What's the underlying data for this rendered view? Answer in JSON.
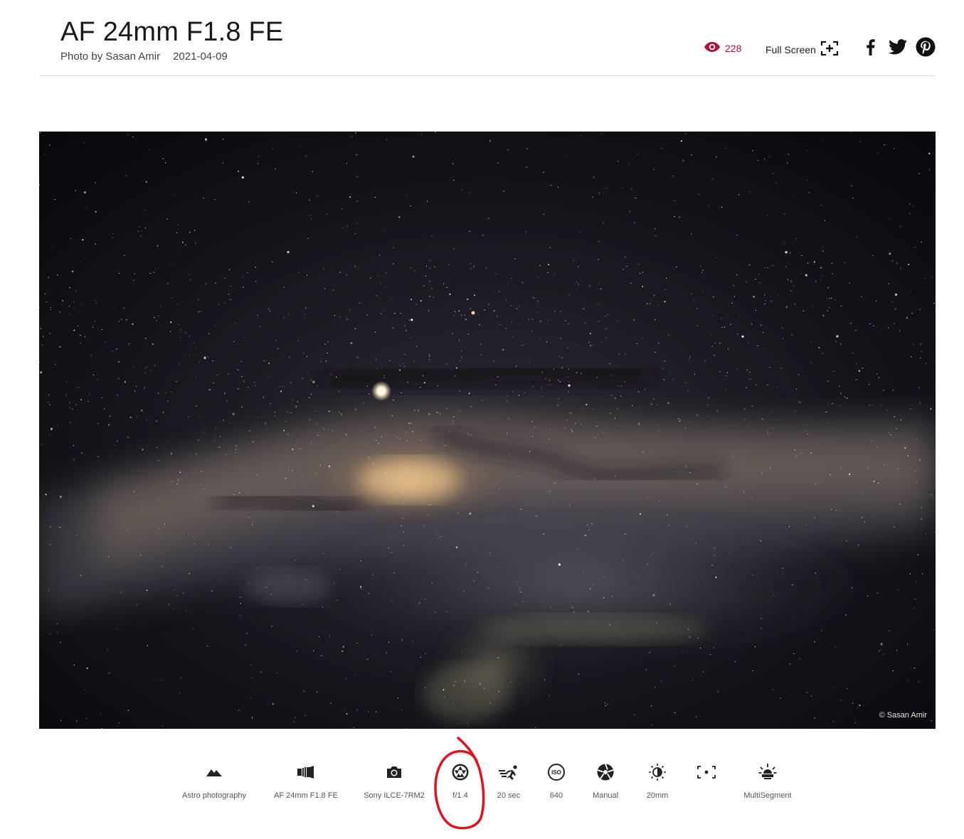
{
  "page": {
    "title": "AF 24mm F1.8 FE",
    "photographer_line": "Photo by Sasan Amir",
    "date": "2021-04-09"
  },
  "header_actions": {
    "views_count": "228",
    "fullscreen_label": "Full Screen",
    "accent_color": "#b5103c",
    "social": [
      {
        "name": "facebook-icon"
      },
      {
        "name": "twitter-icon"
      },
      {
        "name": "pinterest-icon"
      }
    ]
  },
  "photo": {
    "credit": "© Sasan Amir"
  },
  "exif": [
    {
      "icon": "landscape-icon",
      "label": "Astro photography"
    },
    {
      "icon": "lens-icon",
      "label": "AF 24mm F1.8 FE"
    },
    {
      "icon": "camera-icon",
      "label": "Sony ILCE-7RM2"
    },
    {
      "icon": "aperture-icon",
      "label": "f/1.4"
    },
    {
      "icon": "shutter-speed-icon",
      "label": "20 sec"
    },
    {
      "icon": "iso-icon",
      "label": "640"
    },
    {
      "icon": "exposure-mode-icon",
      "label": "Manual"
    },
    {
      "icon": "focal-length-icon",
      "label": "20mm"
    },
    {
      "icon": "focus-point-icon",
      "label": ""
    },
    {
      "icon": "metering-icon",
      "label": "MultiSegment"
    }
  ],
  "annotation": {
    "color": "#e0141e"
  }
}
